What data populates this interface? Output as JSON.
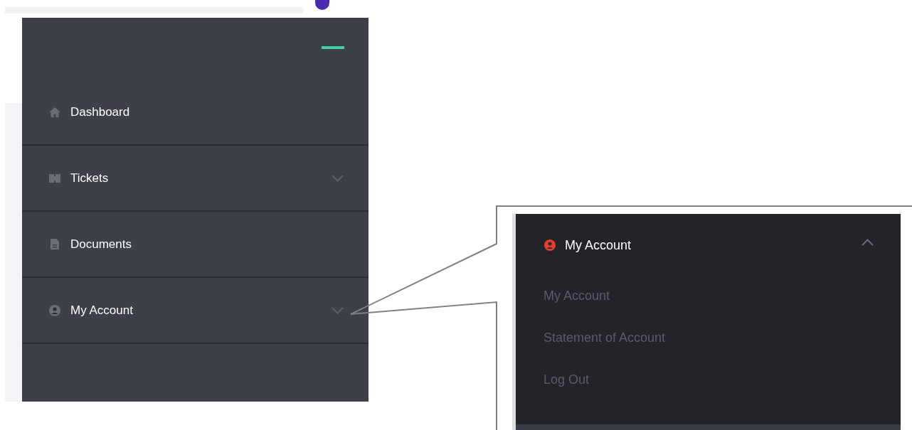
{
  "sidebar": {
    "items": [
      {
        "label": "Dashboard",
        "kind": "link"
      },
      {
        "label": "Tickets",
        "kind": "dropdown",
        "expanded": false
      },
      {
        "label": "Documents",
        "kind": "link"
      },
      {
        "label": "My Account",
        "kind": "dropdown",
        "expanded": false
      }
    ]
  },
  "callout": {
    "heading": {
      "label": "My Account",
      "expanded": true
    },
    "items": [
      {
        "label": "My Account"
      },
      {
        "label": "Statement of Account"
      },
      {
        "label": "Log Out"
      }
    ]
  }
}
